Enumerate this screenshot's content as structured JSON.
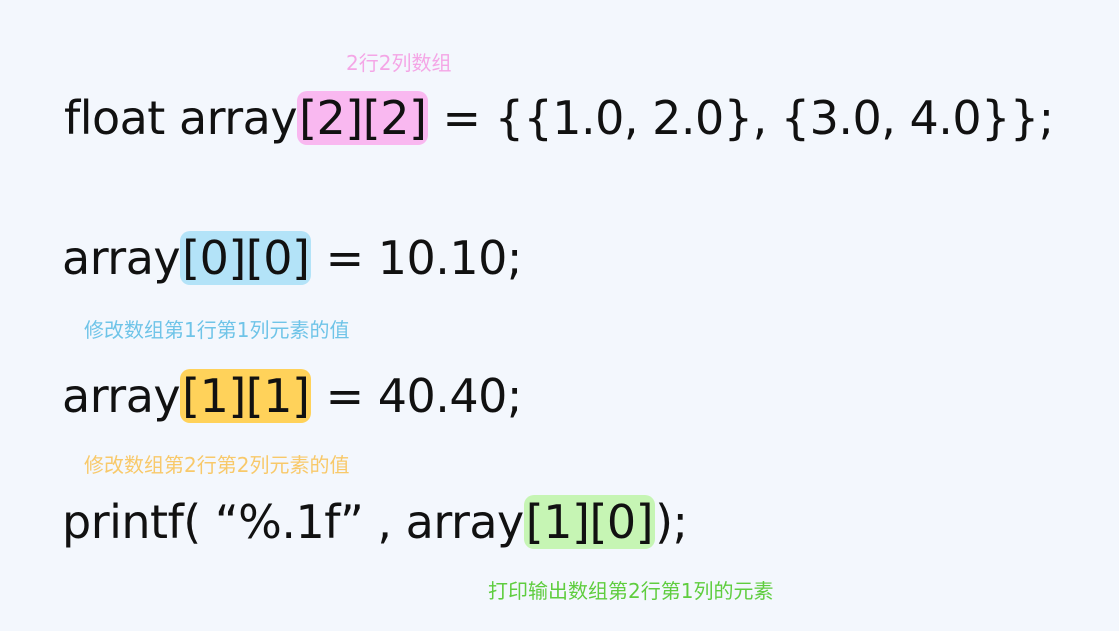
{
  "colors": {
    "background": "#f3f7fd",
    "pink_highlight": "#f9b8f0",
    "pink_text": "#f4a6e6",
    "blue_highlight": "#b3e3f8",
    "blue_text": "#6fc4e8",
    "orange_highlight": "#ffd25a",
    "orange_text": "#f8c96a",
    "green_highlight": "#c6f5b4",
    "green_text": "#5fcd3f"
  },
  "line1": {
    "pre": "float array",
    "hl": "[2][2]",
    "post": " = {{1.0, 2.0}, {3.0, 4.0}};",
    "note": "2行2列数组"
  },
  "line2": {
    "pre": "array",
    "hl": "[0][0]",
    "post": " = 10.10;",
    "note": "修改数组第1行第1列元素的值"
  },
  "line3": {
    "pre": "array",
    "hl": "[1][1]",
    "post": " = 40.40;",
    "note": "修改数组第2行第2列元素的值"
  },
  "line4": {
    "pre": "printf( “%.1f” , array",
    "hl": "[1][0]",
    "post": ");",
    "note": "打印输出数组第2行第1列的元素"
  }
}
